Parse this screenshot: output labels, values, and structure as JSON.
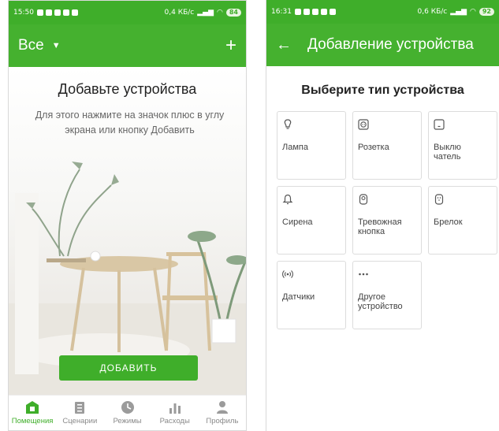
{
  "left": {
    "status": {
      "time": "15:50",
      "speed": "0,4 КБ/с",
      "battery": "84"
    },
    "appbar": {
      "title": "Все"
    },
    "empty": {
      "title": "Добавьте устройства",
      "hint": "Для этого нажмите на значок плюс в углу экрана или кнопку Добавить"
    },
    "add_button": "ДОБАВИТЬ",
    "nav": [
      {
        "label": "Помещения",
        "icon": "rooms-icon"
      },
      {
        "label": "Сценарии",
        "icon": "scenarios-icon"
      },
      {
        "label": "Режимы",
        "icon": "modes-icon"
      },
      {
        "label": "Расходы",
        "icon": "expenses-icon"
      },
      {
        "label": "Профиль",
        "icon": "profile-icon"
      }
    ],
    "colors": {
      "accent": "#3fae2a"
    }
  },
  "right": {
    "status": {
      "time": "16:31",
      "speed": "0,6 КБ/с",
      "battery": "92"
    },
    "appbar": {
      "title": "Добавление устройства"
    },
    "section_title": "Выберите тип устройства",
    "tiles": [
      {
        "label": "Лампа",
        "icon": "lamp-icon"
      },
      {
        "label": "Розетка",
        "icon": "socket-icon"
      },
      {
        "label": "Выклю\nчатель",
        "icon": "switch-icon"
      },
      {
        "label": "Сирена",
        "icon": "siren-icon"
      },
      {
        "label": "Тревожная кнопка",
        "icon": "panic-button-icon"
      },
      {
        "label": "Брелок",
        "icon": "keyfob-icon"
      },
      {
        "label": "Датчики",
        "icon": "sensor-icon"
      },
      {
        "label": "Другое устройство",
        "icon": "more-icon"
      }
    ]
  }
}
